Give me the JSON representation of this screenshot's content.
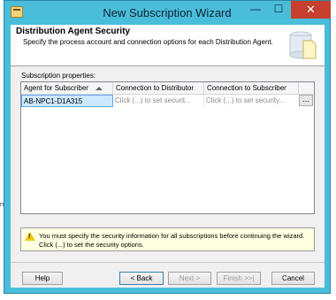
{
  "background": {
    "partial_text": "re"
  },
  "window": {
    "title": "New Subscription Wizard",
    "controls": {
      "minimize": "—",
      "maximize": "☐",
      "close": "✕"
    }
  },
  "header": {
    "title": "Distribution Agent Security",
    "subtitle": "Specify the process account and connection options for each Distribution Agent."
  },
  "grid": {
    "label": "Subscription properties:",
    "columns": [
      "Agent for Subscriber",
      "Connection to Distributor",
      "Connection to Subscriber"
    ],
    "rows": [
      {
        "agent": "AB-NPC1-D1A315",
        "distributor": "Click (...) to set securit...",
        "subscriber": "Click (...) to set security...",
        "button": "..."
      }
    ]
  },
  "warning": {
    "text": "You must specify the security information for all subscriptions before continuing the wizard. Click (...) to set the security options."
  },
  "buttons": {
    "help": "Help",
    "back": "< Back",
    "next": "Next >",
    "finish": "Finish >>|",
    "cancel": "Cancel"
  },
  "colors": {
    "titlebar": "#49bdd9",
    "close": "#c7402f",
    "selection": "#cce8ff",
    "warning_bg": "#ffffe1"
  }
}
